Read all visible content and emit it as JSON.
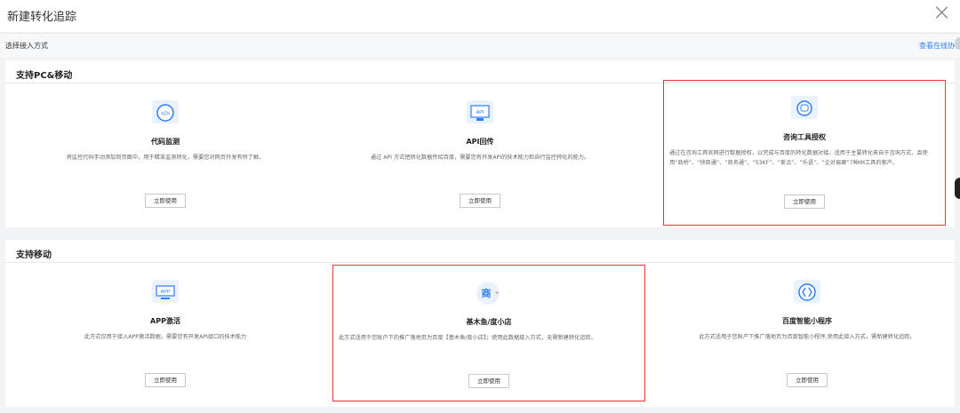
{
  "dialog": {
    "title": "新建转化追踪"
  },
  "header": {
    "subtitle": "选择接入方式",
    "link": "查看在线协议"
  },
  "sections": [
    {
      "title": "支持PC&移动",
      "cards": [
        {
          "title": "代码监测",
          "icon": "code-icon",
          "desc": "将监控代码手动添加到页面中，用于精准监测转化，需要您对网页开发有所了解。",
          "button": "立即使用"
        },
        {
          "title": "API回传",
          "icon": "api-icon",
          "desc": "通过 API 方式把转化数据传给百度，需要您有开发API的技术能力和自行监控转化的能力。",
          "button": "立即使用"
        },
        {
          "title": "咨询工具授权",
          "icon": "chat-tool-icon",
          "desc": "通过在咨询工具官网进行数据授权，以完成与百度的转化数据对接。适用于主要转化来自于咨询方式，且使用“商桥”、“快商通”、“商务通”、“53KF”、“美洽”、“乐语”、“企对易聊”7种IM工具的客户。",
          "button": "立即使用"
        }
      ]
    },
    {
      "title": "支持移动",
      "cards": [
        {
          "title": "APP激活",
          "icon": "app-icon",
          "desc": "此方式仅用于接入APP激活数据，需要您有开发API接口的技术能力",
          "button": "立即使用"
        },
        {
          "title": "基木鱼/度小店",
          "icon": "shop-icon",
          "icon_text": "商",
          "desc": "此方式适用于您账户下的推广落地页为百度【基木鱼/度小店】；使用此数据接入方式，无需新建转化追踪。",
          "button": "立即使用"
        },
        {
          "title": "百度智能小程序",
          "icon": "miniprogram-icon",
          "desc": "此方式适用于您账户下推广落地页为百度智能小程序,使用此接入方式，需新建转化追踪。",
          "button": "立即使用"
        }
      ]
    }
  ],
  "colors": {
    "accent": "#2d7ff9",
    "highlight": "#e23a3a"
  }
}
